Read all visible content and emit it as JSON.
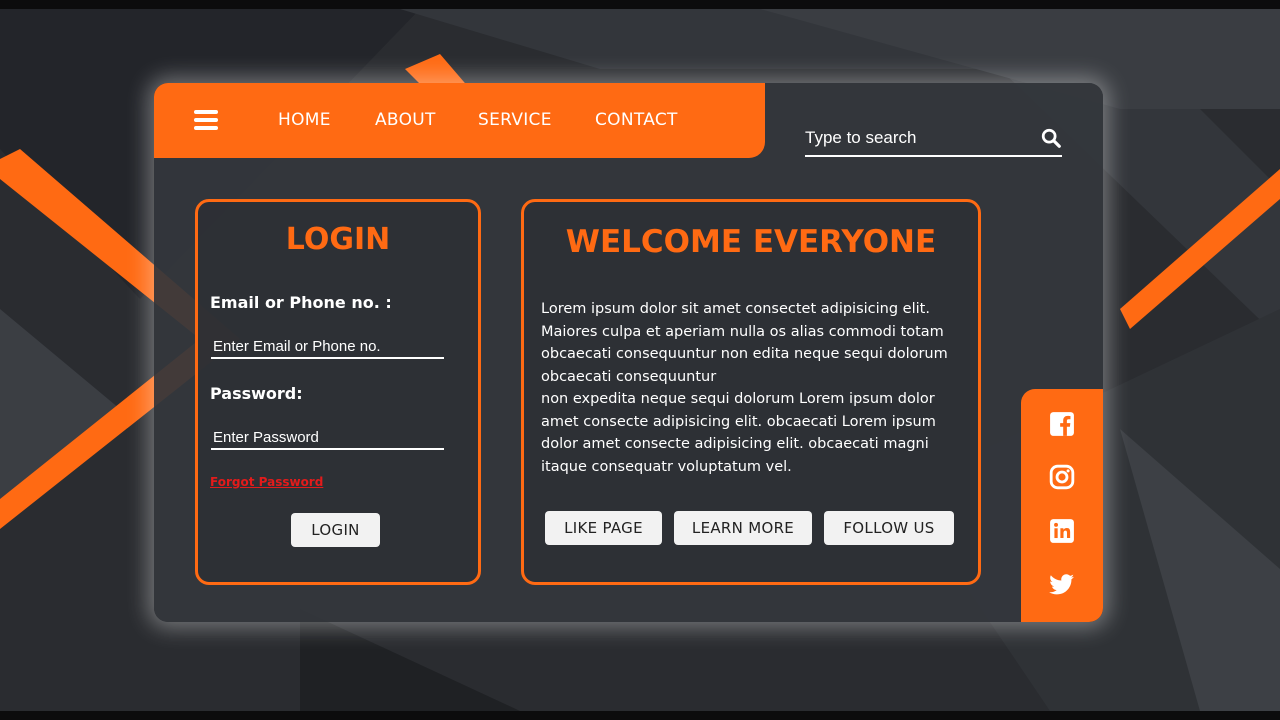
{
  "nav": {
    "menu_icon": "hamburger-menu-icon",
    "links": [
      "HOME",
      "ABOUT",
      "SERVICE",
      "CONTACT"
    ]
  },
  "search": {
    "placeholder": "Type to search",
    "icon": "search-icon"
  },
  "login": {
    "title": "LOGIN",
    "email_label": "Email or Phone no. :",
    "email_placeholder": "Enter Email or Phone no.",
    "password_label": "Password:",
    "password_placeholder": "Enter Password",
    "forgot_link": "Forgot Password",
    "button_label": "LOGIN"
  },
  "welcome": {
    "title": "WELCOME EVERYONE",
    "lines": [
      "Lorem ipsum dolor sit amet consectet adipisicing elit.",
      "Maiores culpa et aperiam nulla os alias commodi totam",
      "obcaecati consequuntur non edita neque sequi dolorum",
      "obcaecati consequuntur",
      "non expedita neque sequi dolorum Lorem ipsum dolor",
      "amet consecte adipisicing elit. obcaecati Lorem ipsum",
      "dolor amet consecte adipisicing elit. obcaecati magni",
      "itaque consequatr voluptatum vel."
    ],
    "buttons": {
      "like": "LIKE PAGE",
      "learn": "LEARN MORE",
      "follow": "FOLLOW US"
    }
  },
  "social": {
    "icons": [
      "facebook-icon",
      "instagram-icon",
      "linkedin-icon",
      "twitter-icon"
    ]
  },
  "colors": {
    "accent": "#ff6a13",
    "card_bg": "#34373c",
    "page_bg": "#2a2c30",
    "link_red": "#e31b1b"
  }
}
